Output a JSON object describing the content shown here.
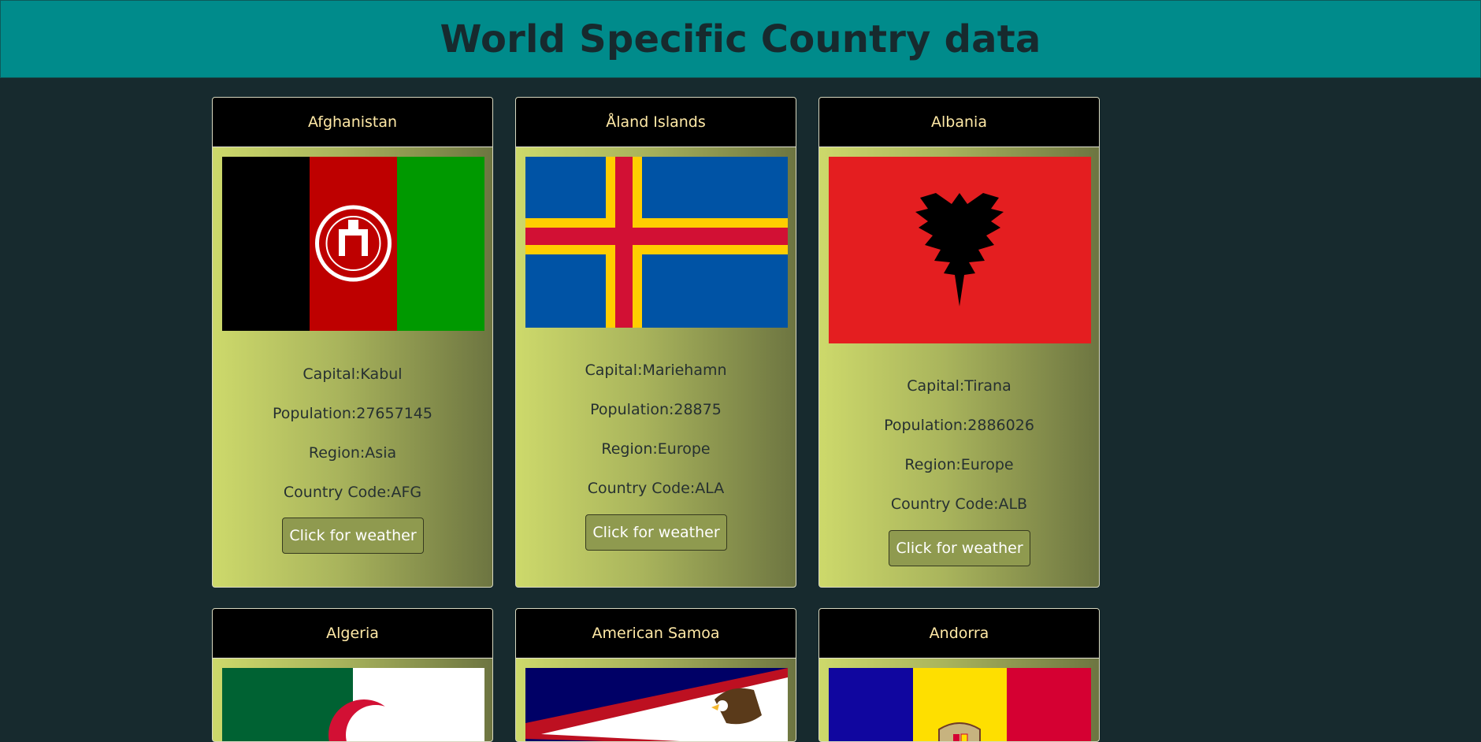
{
  "header": {
    "title": "World Specific Country data"
  },
  "labels": {
    "capital": "Capital:",
    "population": "Population:",
    "region": "Region:",
    "country_code": "Country Code:"
  },
  "cards": [
    {
      "name": "Afghanistan",
      "capital_line": "Capital:Kabul",
      "population_line": "Population:27657145",
      "region_line": "Region:Asia",
      "code_line": "Country Code:AFG",
      "button": "Click for weather",
      "flag": "afghanistan-flag"
    },
    {
      "name": "Åland Islands",
      "capital_line": "Capital:Mariehamn",
      "population_line": "Population:28875",
      "region_line": "Region:Europe",
      "code_line": "Country Code:ALA",
      "button": "Click for weather",
      "flag": "aland-flag"
    },
    {
      "name": "Albania",
      "capital_line": "Capital:Tirana",
      "population_line": "Population:2886026",
      "region_line": "Region:Europe",
      "code_line": "Country Code:ALB",
      "button": "Click for weather",
      "flag": "albania-flag"
    },
    {
      "name": "Algeria",
      "flag": "algeria-flag"
    },
    {
      "name": "American Samoa",
      "flag": "american-samoa-flag"
    },
    {
      "name": "Andorra",
      "flag": "andorra-flag"
    }
  ],
  "colors": {
    "page_bg": "#172a2e",
    "header_bg": "#008b8b",
    "card_gradient_start": "#cdd96b",
    "card_gradient_end": "#6d7541",
    "card_title_text": "#ffe9a6",
    "button_bg": "#8f9a4f"
  }
}
